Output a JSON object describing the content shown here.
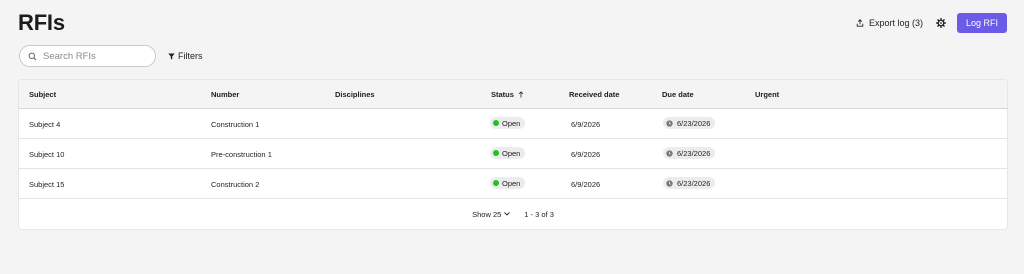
{
  "header": {
    "title": "RFIs",
    "export_label": "Export log (3)",
    "log_label": "Log RFI"
  },
  "toolbar": {
    "search_placeholder": "Search RFIs",
    "search_value": "",
    "filters_label": "Filters"
  },
  "table": {
    "columns": {
      "subject": "Subject",
      "number": "Number",
      "disciplines": "Disciplines",
      "status": "Status",
      "received": "Received date",
      "due": "Due date",
      "urgent": "Urgent"
    },
    "sort": {
      "column": "Status",
      "direction": "ascending"
    },
    "rows": [
      {
        "subject": "Subject 4",
        "number": "Construction 1",
        "disciplines": "",
        "status": "Open",
        "received": "6/9/2026",
        "due": "6/23/2026",
        "urgent": ""
      },
      {
        "subject": "Subject 10",
        "number": "Pre-construction 1",
        "disciplines": "",
        "status": "Open",
        "received": "6/9/2026",
        "due": "6/23/2026",
        "urgent": ""
      },
      {
        "subject": "Subject 15",
        "number": "Construction 2",
        "disciplines": "",
        "status": "Open",
        "received": "6/9/2026",
        "due": "6/23/2026",
        "urgent": ""
      }
    ]
  },
  "pagination": {
    "page_size_label": "Show 25",
    "range_label": "1 - 3 of 3"
  },
  "colors": {
    "primary_button": "#6b5ce7",
    "status_open": "#1fc21f",
    "page_background": "#f4f4f4"
  },
  "icons": {
    "export": "export-icon",
    "settings": "gear-icon",
    "search": "search-icon",
    "filter": "filter-icon",
    "sort": "arrow-up-icon",
    "due": "clock-icon",
    "page_size": "chevron-down-icon"
  }
}
